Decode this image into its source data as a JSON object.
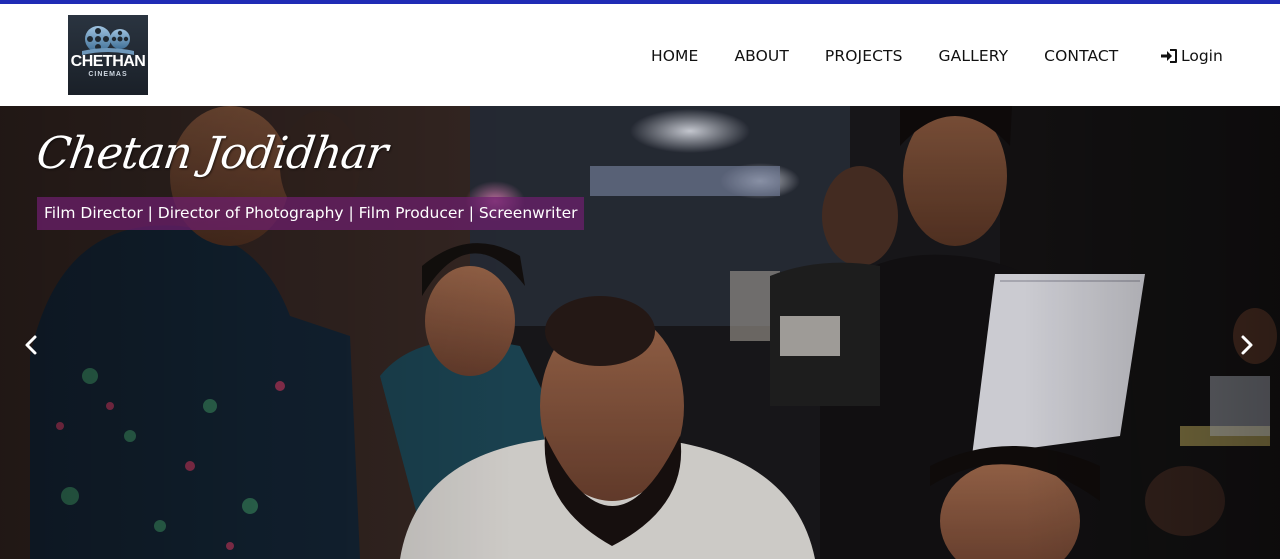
{
  "brand": {
    "logo_title": "CHETHAN",
    "logo_subtitle": "CINEMAS"
  },
  "nav": {
    "links": [
      {
        "label": "HOME"
      },
      {
        "label": "ABOUT"
      },
      {
        "label": "PROJECTS"
      },
      {
        "label": "GALLERY"
      },
      {
        "label": "CONTACT"
      }
    ],
    "login_label": "Login",
    "login_icon": "sign-in-icon"
  },
  "hero": {
    "name": "Chetan Jodidhar",
    "roles": "Film Director | Director of Photography | Film Producer | Screenwriter",
    "prev_icon": "chevron-left-icon",
    "next_icon": "chevron-right-icon"
  },
  "colors": {
    "top_border": "#1f2bb5",
    "roles_bg": "#6e1e6e",
    "nav_text": "#111111"
  }
}
